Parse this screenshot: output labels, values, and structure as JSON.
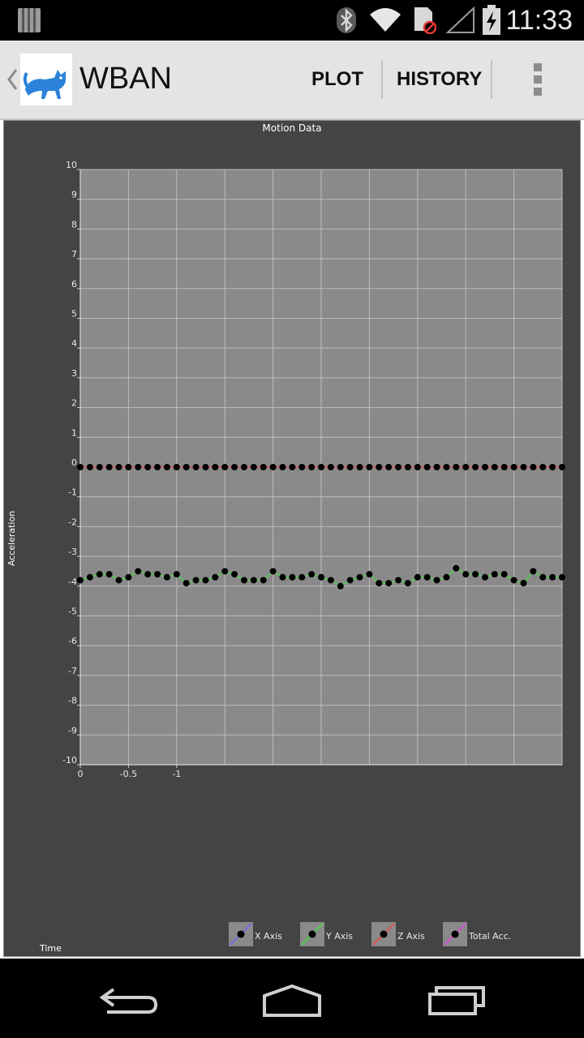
{
  "status_bar": {
    "time": "11:33",
    "icons": [
      "notification-bars-icon",
      "bluetooth-icon",
      "wifi-icon",
      "no-sim-icon",
      "cell-signal-icon",
      "battery-charging-icon"
    ]
  },
  "action_bar": {
    "title": "WBAN",
    "plot_label": "PLOT",
    "history_label": "HISTORY",
    "icons": [
      "back-chevron-icon",
      "cat-app-logo-icon",
      "overflow-menu-icon"
    ]
  },
  "nav_bar": {
    "icons": [
      "back-icon",
      "home-icon",
      "recent-apps-icon"
    ]
  },
  "colors": {
    "chart_bg": "#444444",
    "plot_bg": "#8a8a8a",
    "grid": "#bdbdbd",
    "x_axis": "#6f6fe0",
    "y_axis": "#4ccf4c",
    "z_axis": "#e05555",
    "total": "#d24fd2",
    "point": "#000000"
  },
  "chart_data": {
    "type": "line",
    "title": "Motion Data",
    "xlabel": "Time",
    "ylabel": "Acceleration",
    "ylim": [
      -10,
      10
    ],
    "y_ticks": [
      "10",
      "9",
      "8",
      "7",
      "6",
      "5",
      "4",
      "3",
      "2",
      "1",
      "0",
      "-1",
      "-2",
      "-3",
      "-4",
      "-5",
      "-6",
      "-7",
      "-8",
      "-9",
      "-10"
    ],
    "x_ticks": [
      "0",
      "-0.5",
      "-1"
    ],
    "x_count": 51,
    "series": [
      {
        "name": "X Axis",
        "color": "#6f6fe0",
        "values": []
      },
      {
        "name": "Y Axis",
        "color": "#4ccf4c",
        "values": [
          -3.8,
          -3.7,
          -3.6,
          -3.6,
          -3.8,
          -3.7,
          -3.5,
          -3.6,
          -3.6,
          -3.7,
          -3.6,
          -3.9,
          -3.8,
          -3.8,
          -3.7,
          -3.5,
          -3.6,
          -3.8,
          -3.8,
          -3.8,
          -3.5,
          -3.7,
          -3.7,
          -3.7,
          -3.6,
          -3.7,
          -3.8,
          -4.0,
          -3.8,
          -3.7,
          -3.6,
          -3.9,
          -3.9,
          -3.8,
          -3.9,
          -3.7,
          -3.7,
          -3.8,
          -3.7,
          -3.4,
          -3.6,
          -3.6,
          -3.7,
          -3.6,
          -3.6,
          -3.8,
          -3.9,
          -3.5,
          -3.7,
          -3.7,
          -3.7
        ]
      },
      {
        "name": "Z Axis",
        "color": "#e05555",
        "values": [
          0,
          0,
          0,
          0,
          0,
          0,
          0,
          0,
          0,
          0,
          0,
          0,
          0,
          0,
          0,
          0,
          0,
          0,
          0,
          0,
          0,
          0,
          0,
          0,
          0,
          0,
          0,
          0,
          0,
          0,
          0,
          0,
          0,
          0,
          0,
          0,
          0,
          0,
          0,
          0,
          0,
          0,
          0,
          0,
          0,
          0,
          0,
          0,
          0,
          0,
          0
        ]
      },
      {
        "name": "Total Acc.",
        "color": "#d24fd2",
        "values": []
      }
    ]
  }
}
